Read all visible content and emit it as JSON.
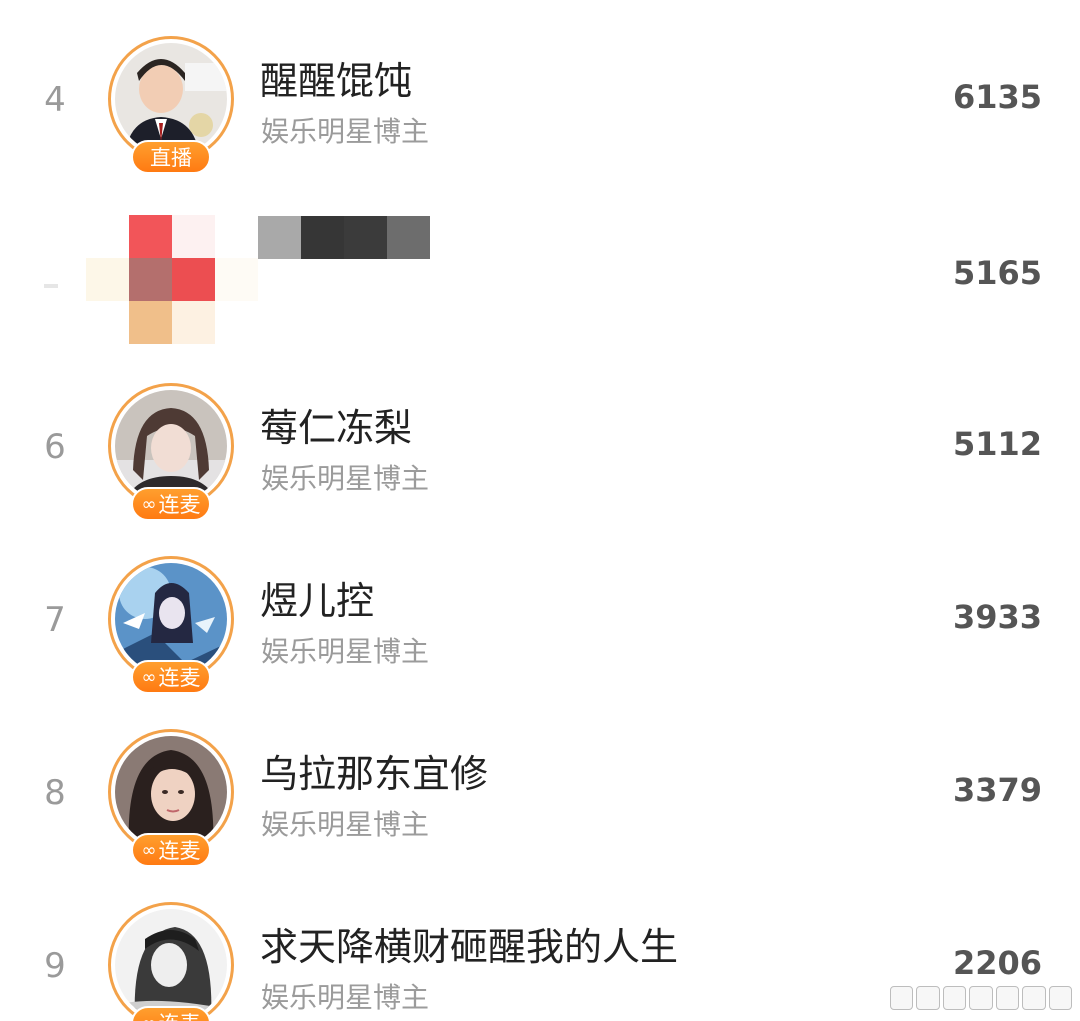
{
  "rows": [
    {
      "rank": "4",
      "name": "醒醒馄饨",
      "category": "娱乐明星博主",
      "score": "6135",
      "badge": "直播",
      "badge_icon": ""
    },
    {
      "rank": "",
      "name": "",
      "category": "",
      "score": "5165",
      "badge": "",
      "badge_icon": ""
    },
    {
      "rank": "6",
      "name": "莓仁冻梨",
      "category": "娱乐明星博主",
      "score": "5112",
      "badge": "连麦",
      "badge_icon": "∞"
    },
    {
      "rank": "7",
      "name": "煜儿控",
      "category": "娱乐明星博主",
      "score": "3933",
      "badge": "连麦",
      "badge_icon": "∞"
    },
    {
      "rank": "8",
      "name": "乌拉那东宜修",
      "category": "娱乐明星博主",
      "score": "3379",
      "badge": "连麦",
      "badge_icon": "∞"
    },
    {
      "rank": "9",
      "name": "求天降横财砸醒我的人生",
      "category": "娱乐明星博主",
      "score": "2206",
      "badge": "连麦",
      "badge_icon": "∞"
    }
  ],
  "colors": {
    "badge_orange": "#ff8a1e",
    "ring_orange": "#f3a24a",
    "rank_gray": "#9a9a9a",
    "name_dark": "#222222",
    "sub_gray": "#9b9b9b"
  }
}
